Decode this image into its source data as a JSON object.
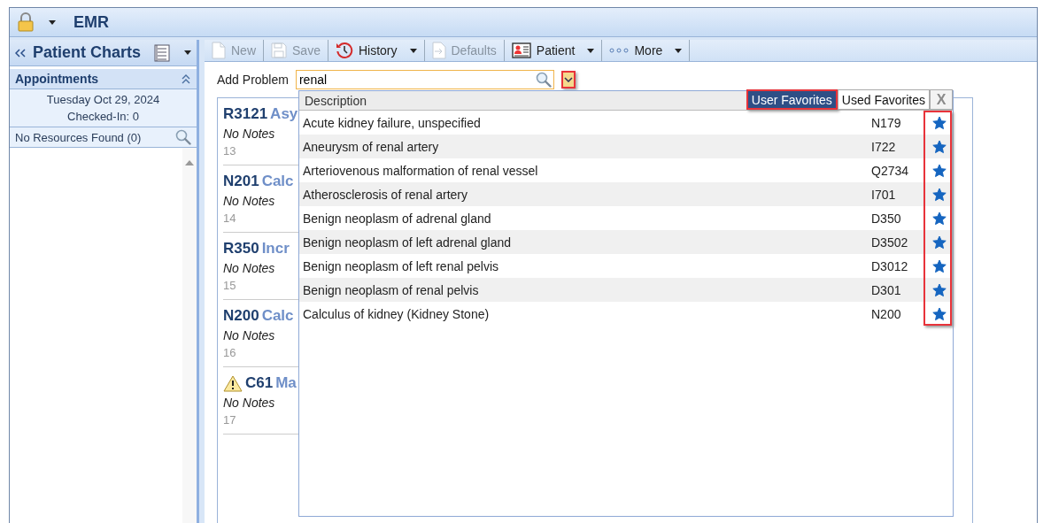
{
  "window": {
    "title": "EMR"
  },
  "sidebar": {
    "title": "Patient Charts",
    "section": {
      "title": "Appointments",
      "expanded": true
    },
    "date": "Tuesday Oct 29, 2024",
    "checked_in": "Checked-In: 0",
    "resources": "No Resources Found (0)"
  },
  "toolbar": [
    {
      "kind": "new",
      "label": "New",
      "disabled": true,
      "has_menu": false
    },
    {
      "kind": "save",
      "label": "Save",
      "disabled": true,
      "has_menu": false
    },
    {
      "kind": "history",
      "label": "History",
      "disabled": false,
      "has_menu": true
    },
    {
      "kind": "defaults",
      "label": "Defaults",
      "disabled": true,
      "has_menu": false
    },
    {
      "kind": "patient",
      "label": "Patient",
      "disabled": false,
      "has_menu": true
    },
    {
      "kind": "more",
      "label": "More",
      "disabled": false,
      "has_menu": true
    }
  ],
  "add_problem": {
    "label": "Add Problem",
    "value": "renal",
    "dropdown_highlighted": true
  },
  "problems": [
    {
      "code": "R3121",
      "title": "Asy",
      "notes": "No Notes",
      "number": "13",
      "warning": false
    },
    {
      "code": "N201",
      "title": "Calc",
      "notes": "No Notes",
      "number": "14",
      "warning": false
    },
    {
      "code": "R350",
      "title": "Incr",
      "notes": "No Notes",
      "number": "15",
      "warning": false
    },
    {
      "code": "N200",
      "title": "Calc",
      "notes": "No Notes",
      "number": "16",
      "warning": false
    },
    {
      "code": "C61",
      "title": "Ma",
      "notes": "No Notes",
      "number": "17",
      "warning": true
    }
  ],
  "popup": {
    "column": "Description",
    "tabs": [
      {
        "label": "User Favorites",
        "selected": true,
        "highlighted": true
      },
      {
        "label": "Used Favorites",
        "selected": false,
        "highlighted": false
      }
    ],
    "close": "X",
    "favorites_highlighted": true,
    "rows": [
      {
        "description": "Acute kidney failure, unspecified",
        "code": "N179",
        "favorite": true
      },
      {
        "description": "Aneurysm of renal artery",
        "code": "I722",
        "favorite": true
      },
      {
        "description": "Arteriovenous malformation of renal vessel",
        "code": "Q2734",
        "favorite": true
      },
      {
        "description": "Atherosclerosis of renal artery",
        "code": "I701",
        "favorite": true
      },
      {
        "description": "Benign neoplasm of adrenal gland",
        "code": "D350",
        "favorite": true
      },
      {
        "description": "Benign neoplasm of left adrenal gland",
        "code": "D3502",
        "favorite": true
      },
      {
        "description": "Benign neoplasm of left renal pelvis",
        "code": "D3012",
        "favorite": true
      },
      {
        "description": "Benign neoplasm of renal pelvis",
        "code": "D301",
        "favorite": true
      },
      {
        "description": "Calculus of kidney (Kidney Stone)",
        "code": "N200",
        "favorite": true
      }
    ]
  }
}
